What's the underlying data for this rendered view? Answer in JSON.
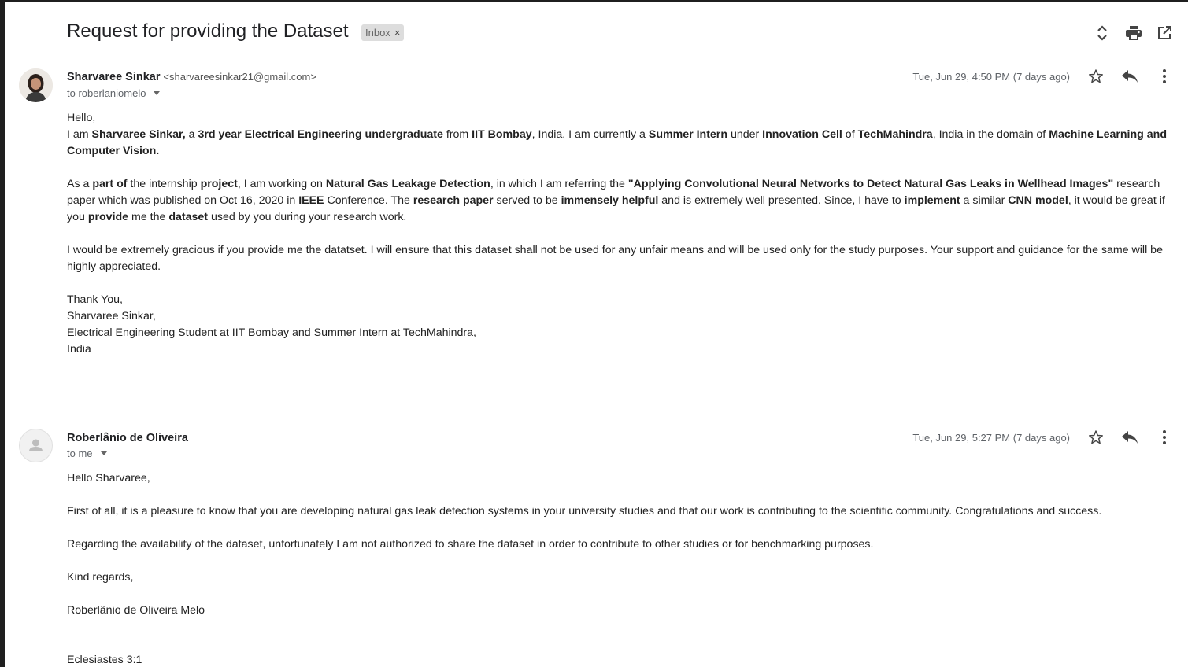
{
  "thread": {
    "subject": "Request for providing the Dataset",
    "label": "Inbox",
    "label_remove": "×",
    "icons": [
      "expand-collapse-icon",
      "print-icon",
      "open-new-window-icon"
    ]
  },
  "messages": [
    {
      "sender_name": "Sharvaree Sinkar",
      "sender_email": "<sharvareesinkar21@gmail.com>",
      "to": "to roberlaniomelo",
      "date": "Tue, Jun 29, 4:50 PM (7 days ago)",
      "body": {
        "greeting": "Hello,",
        "p1": [
          {
            "t": "I am "
          },
          {
            "t": "Sharvaree Sinkar,",
            "b": true
          },
          {
            "t": " a "
          },
          {
            "t": "3rd year Electrical Engineering undergraduate",
            "b": true
          },
          {
            "t": " from "
          },
          {
            "t": "IIT Bombay",
            "b": true
          },
          {
            "t": ", India. I am currently a "
          },
          {
            "t": "Summer Intern",
            "b": true
          },
          {
            "t": "  under "
          },
          {
            "t": "Innovation Cell",
            "b": true
          },
          {
            "t": " of "
          },
          {
            "t": "TechMahindra",
            "b": true
          },
          {
            "t": ", India in the domain of "
          },
          {
            "t": "Machine Learning and Computer Vision.",
            "b": true
          }
        ],
        "p2": [
          {
            "t": "As a "
          },
          {
            "t": "part of",
            "b": true
          },
          {
            "t": " the internship "
          },
          {
            "t": "project",
            "b": true
          },
          {
            "t": ", I am working on "
          },
          {
            "t": "Natural Gas Leakage Detection",
            "b": true
          },
          {
            "t": ", in which I am referring the "
          },
          {
            "t": "\"Applying Convolutional Neural Networks to Detect Natural Gas Leaks in Wellhead Images\"",
            "b": true
          },
          {
            "t": " research paper which was published on Oct 16, 2020 in "
          },
          {
            "t": "IEEE",
            "b": true
          },
          {
            "t": " Conference. The "
          },
          {
            "t": "research paper",
            "b": true
          },
          {
            "t": " served to be "
          },
          {
            "t": "immensely helpful",
            "b": true
          },
          {
            "t": " and is extremely well presented. Since, I have to "
          },
          {
            "t": "implement",
            "b": true
          },
          {
            "t": " a similar "
          },
          {
            "t": "CNN model",
            "b": true
          },
          {
            "t": ", it would be great if you "
          },
          {
            "t": "provide",
            "b": true
          },
          {
            "t": " me the "
          },
          {
            "t": "dataset",
            "b": true
          },
          {
            "t": " used by you during your research work."
          }
        ],
        "p3": "I would be extremely gracious if you provide me the datatset. I will ensure that this dataset shall not be used for any unfair means and will be used only for the study purposes. Your support and guidance for the same will be highly appreciated.",
        "signature": [
          "Thank You,",
          "Sharvaree Sinkar,",
          "Electrical Engineering Student at IIT Bombay and Summer Intern at TechMahindra,",
          "India"
        ]
      }
    },
    {
      "sender_name": "Roberlânio de Oliveira",
      "to": "to me",
      "date": "Tue, Jun 29, 5:27 PM (7 days ago)",
      "body": {
        "greeting": "Hello Sharvaree,",
        "p1": "First of all, it is a pleasure to know that you are developing natural gas leak detection systems in your university studies and that our work is contributing to the scientific community. Congratulations and success.",
        "p2": "Regarding the availability of the dataset, unfortunately I am not authorized to share the dataset in order to contribute to other studies or for benchmarking purposes.",
        "closing": "Kind regards,",
        "signature": "Roberlânio de Oliveira Melo",
        "quote": "Eclesiastes 3:1"
      }
    }
  ],
  "message_icons": [
    "star-icon",
    "reply-icon",
    "more-options-icon"
  ],
  "colors": {
    "icon": "#5f6368",
    "label_chip": "#dddddd",
    "divider": "#e5e5e5"
  }
}
